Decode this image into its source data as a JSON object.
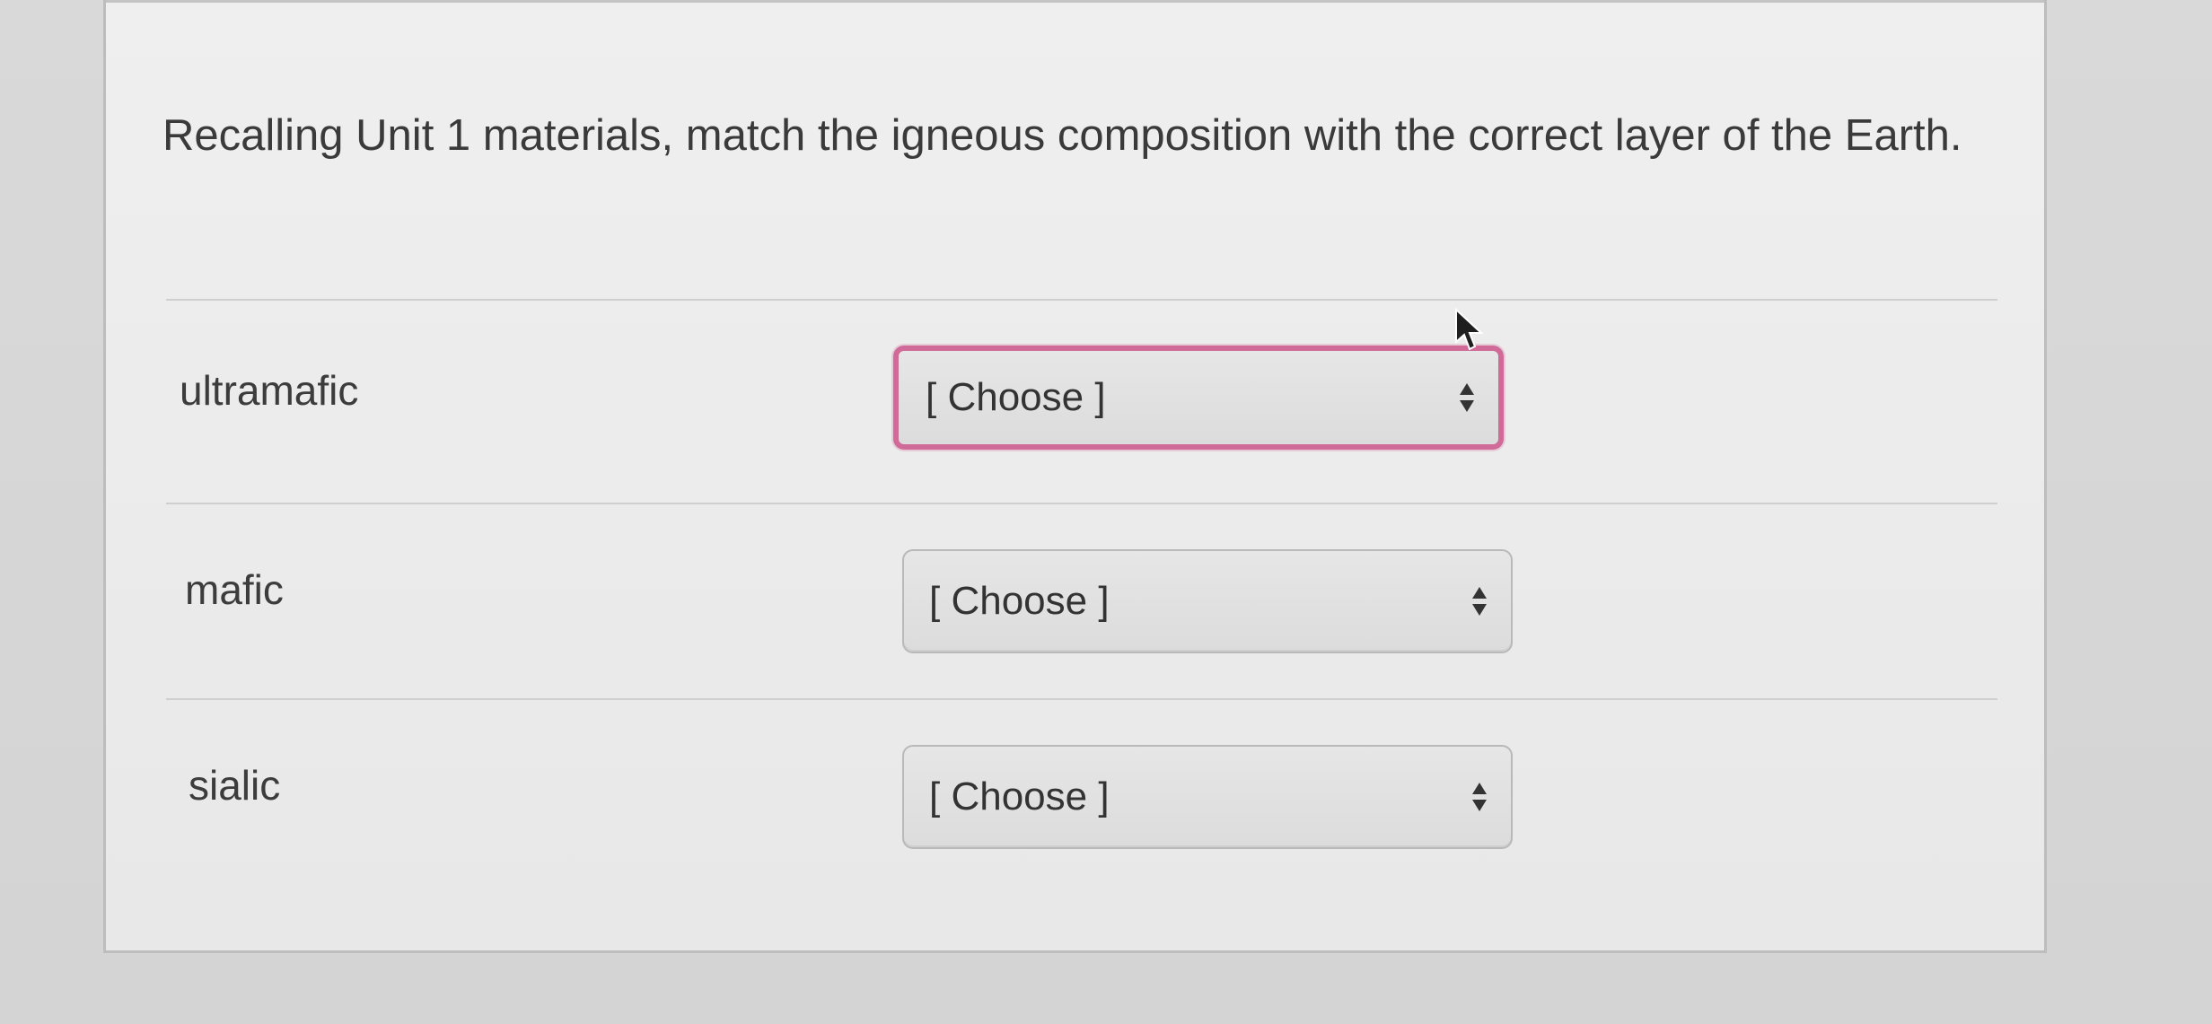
{
  "question": {
    "text": "Recalling Unit 1 materials, match the igneous composition with the correct layer of the Earth."
  },
  "rows": [
    {
      "label": "ultramafic",
      "select_value": "[ Choose ]",
      "focused": true
    },
    {
      "label": "mafic",
      "select_value": "[ Choose ]",
      "focused": false
    },
    {
      "label": "sialic",
      "select_value": "[ Choose ]",
      "focused": false
    }
  ],
  "icons": {
    "select_arrows": "up-down-arrows-icon",
    "cursor": "mouse-pointer-icon"
  },
  "colors": {
    "focus_ring": "#d06a98",
    "text": "#3a3a3a",
    "card_background": "#ececec",
    "page_background": "#d6d6d6"
  }
}
